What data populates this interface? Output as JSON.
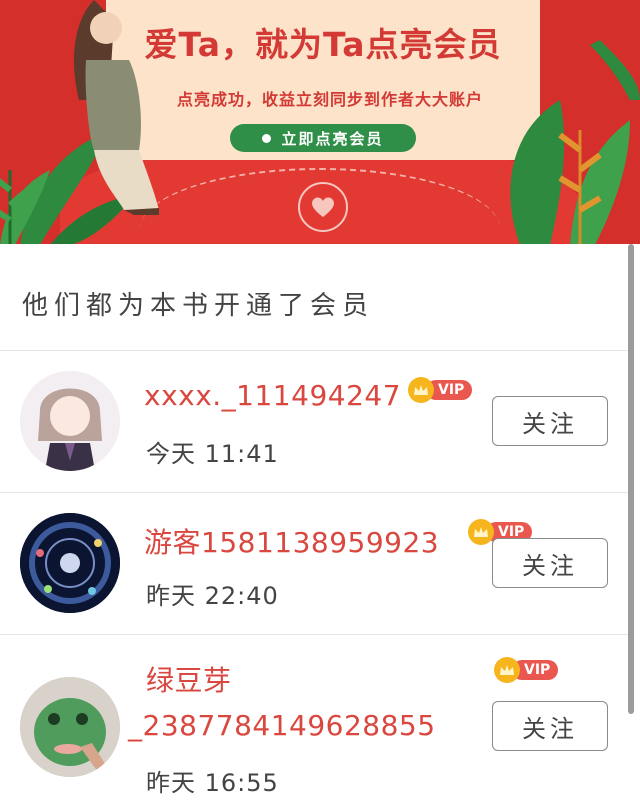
{
  "banner": {
    "title": "爱Ta，就为Ta点亮会员",
    "subtitle": "点亮成功，收益立刻同步到作者大大账户",
    "cta_label": "立即点亮会员"
  },
  "section": {
    "title": "他们都为本书开通了会员"
  },
  "members": [
    {
      "name": "xxxx._111494247",
      "time": "今天 11:41",
      "vip": "VIP",
      "follow_label": "关注"
    },
    {
      "name": "游客1581138959923",
      "time": "昨天 22:40",
      "vip": "VIP",
      "follow_label": "关注"
    },
    {
      "name_line1": "绿豆芽",
      "name_line2": "_2387784149628855",
      "time": "昨天 16:55",
      "vip": "VIP",
      "follow_label": "关注"
    }
  ],
  "colors": {
    "accent_red": "#d9473f",
    "banner_red": "#d42f2a",
    "cta_green": "#2f8e47",
    "vip_gold": "#f6b51d"
  }
}
